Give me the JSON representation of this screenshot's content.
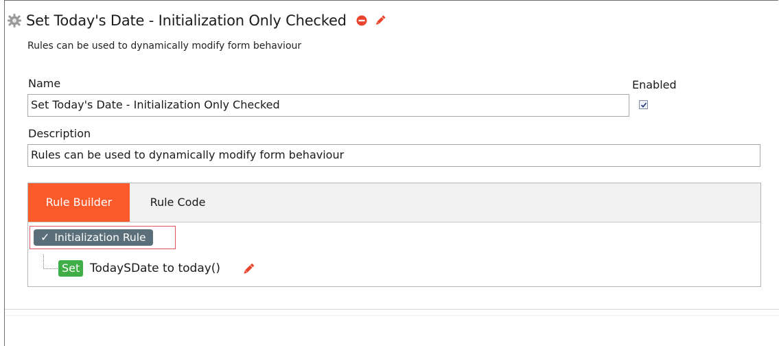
{
  "rule": {
    "title": "Set Today's Date - Initialization Only Checked",
    "subtitle": "Rules can be used to dynamically modify form behaviour"
  },
  "form": {
    "name_label": "Name",
    "name_value": "Set Today's Date - Initialization Only Checked",
    "enabled_label": "Enabled",
    "enabled_checked": true,
    "description_label": "Description",
    "description_value": "Rules can be used to dynamically modify form behaviour"
  },
  "tabs": [
    {
      "label": "Rule Builder",
      "active": true
    },
    {
      "label": "Rule Code",
      "active": false
    }
  ],
  "builder": {
    "rule_type": "Initialization Rule",
    "check_glyph": "✓",
    "action_keyword": "Set",
    "action_text": "TodaySDate to today()"
  },
  "icons": {
    "header": [
      "gear-icon",
      "remove-icon",
      "edit-pencil-icon"
    ],
    "action": "edit-pencil-icon"
  },
  "colors": {
    "active_tab": "#fb5a2b",
    "rule_pill": "#5b6f7b",
    "set_badge": "#3fae46",
    "remove_icon": "#e8452c",
    "highlight_border": "#e0535a"
  }
}
